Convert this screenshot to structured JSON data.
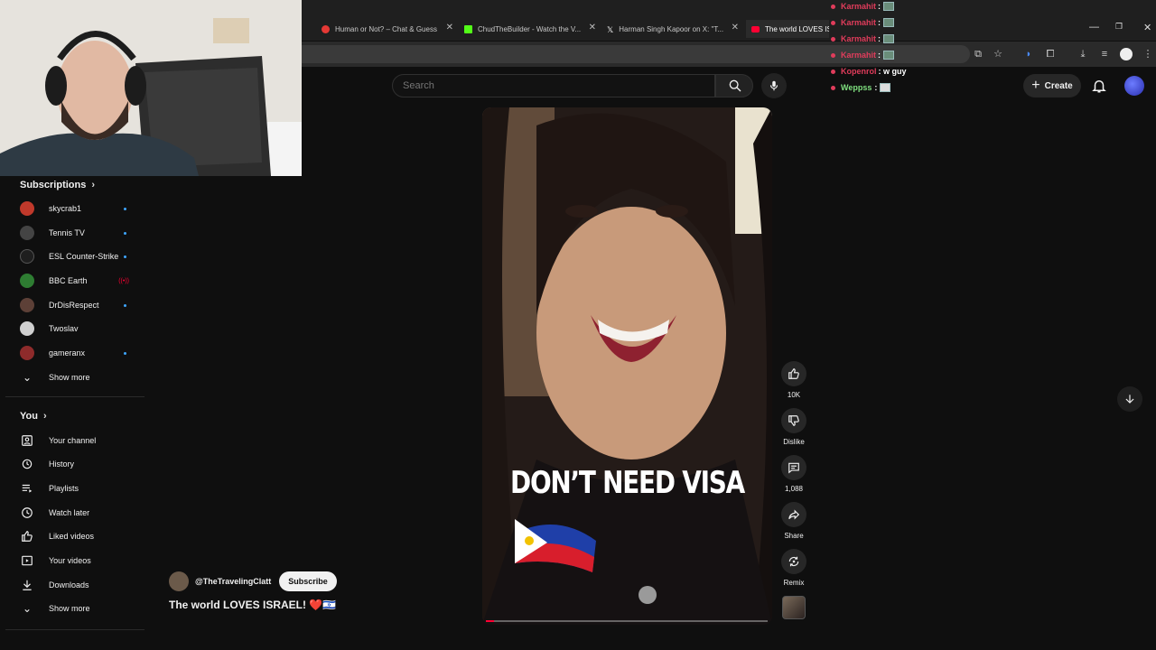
{
  "browser": {
    "tabs": [
      {
        "title": "Human or Not? – Chat & Guess",
        "favicon_color": "#e53935"
      },
      {
        "title": "ChudTheBuilder - Watch the V...",
        "favicon_color": "#53fc18"
      },
      {
        "title": "Harman Singh Kapoor on X: \"T...",
        "favicon_color": "#ffffff"
      },
      {
        "title": "The world LOVES ISRAEL!",
        "favicon_color": "#ff0033"
      }
    ]
  },
  "header": {
    "search_placeholder": "Search",
    "create_label": "Create"
  },
  "chat": [
    {
      "user": "Karmahit",
      "message": "",
      "color": "#e03c5b"
    },
    {
      "user": "Karmahit",
      "message": "",
      "color": "#e03c5b"
    },
    {
      "user": "Karmahit",
      "message": "",
      "color": "#e03c5b"
    },
    {
      "user": "Karmahit",
      "message": "",
      "color": "#e03c5b"
    },
    {
      "user": "Kopenrol",
      "message": ": w guy",
      "color": "#e03c5b"
    },
    {
      "user": "Weppss",
      "message": ":",
      "color": "#7fe07f"
    }
  ],
  "sidebar": {
    "subscriptions_title": "Subscriptions",
    "subscriptions": [
      {
        "name": "skycrab1",
        "avatar_color": "#c0392b",
        "indicator": "live"
      },
      {
        "name": "Tennis TV",
        "avatar_color": "#444444",
        "indicator": "live"
      },
      {
        "name": "ESL Counter-Strike",
        "avatar_color": "#1e1e1e",
        "indicator": "live"
      },
      {
        "name": "BBC Earth",
        "avatar_color": "#2e7d32",
        "indicator": "stream"
      },
      {
        "name": "DrDisRespect",
        "avatar_color": "#5d4037",
        "indicator": "live"
      },
      {
        "name": "Twoslav",
        "avatar_color": "#cfcfcf",
        "indicator": ""
      },
      {
        "name": "gameranx",
        "avatar_color": "#8e2b2b",
        "indicator": "live"
      }
    ],
    "subs_show_more": "Show more",
    "you_title": "You",
    "you_items": [
      {
        "label": "Your channel",
        "icon": "person-icon"
      },
      {
        "label": "History",
        "icon": "history-icon"
      },
      {
        "label": "Playlists",
        "icon": "playlist-icon"
      },
      {
        "label": "Watch later",
        "icon": "clock-icon"
      },
      {
        "label": "Liked videos",
        "icon": "thumb-up-icon"
      },
      {
        "label": "Your videos",
        "icon": "video-icon"
      },
      {
        "label": "Downloads",
        "icon": "download-icon"
      }
    ],
    "you_show_more": "Show more"
  },
  "short": {
    "caption": "DON’T NEED VISA",
    "channel": "@TheTravelingClatt",
    "subscribe_label": "Subscribe",
    "title": "The world LOVES ISRAEL! ❤️🇮🇱",
    "progress": 0.03
  },
  "actions": {
    "like_count": "10K",
    "dislike_label": "Dislike",
    "comment_count": "1,088",
    "share_label": "Share",
    "remix_label": "Remix"
  }
}
